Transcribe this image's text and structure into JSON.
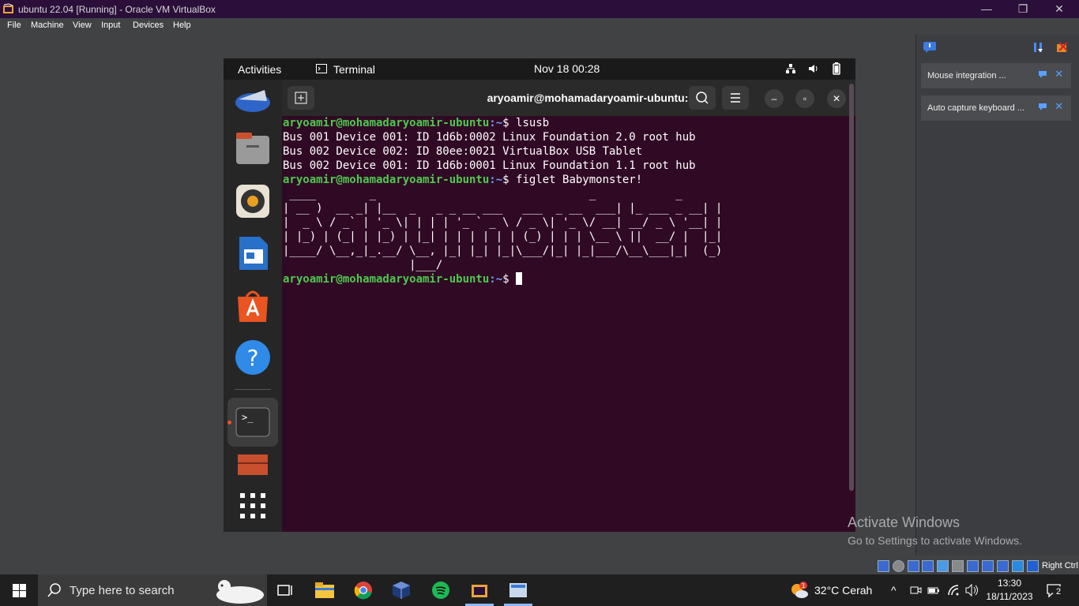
{
  "window": {
    "title": "ubuntu 22.04 [Running] - Oracle VM VirtualBox",
    "controls": [
      "—",
      "❐",
      "✕"
    ]
  },
  "menu": [
    "File",
    "Machine",
    "View",
    "Input",
    "Devices",
    "Help"
  ],
  "notifications": [
    {
      "text": "Mouse integration ..."
    },
    {
      "text": "Auto capture keyboard ..."
    }
  ],
  "gnome": {
    "activities": "Activities",
    "app": "Terminal",
    "clock": "Nov 18  00:28"
  },
  "terminal": {
    "title": "aryoamir@mohamadaryoamir-ubuntu: ~",
    "prompt_user": "aryoamir@mohamadaryoamir-ubuntu",
    "prompt_path": ":~",
    "prompt_sign": "$ ",
    "cmd1": "lsusb",
    "out1": "Bus 001 Device 001: ID 1d6b:0002 Linux Foundation 2.0 root hub",
    "out2": "Bus 002 Device 002: ID 80ee:0021 VirtualBox USB Tablet",
    "out3": "Bus 002 Device 001: ID 1d6b:0001 Linux Foundation 1.1 root hub",
    "cmd2": "figlet Babymonster!",
    "figlet": [
      " ____        _                                _            _ ",
      "| __ )  __ _| |__  _   _ _ __ ___   ___  _ __  ___| |_ ___ _ __| |",
      "|  _ \\ / _` | '_ \\| | | | '_ ` _ \\ / _ \\| '_ \\/ __| __/ _ \\ '__| |",
      "| |_) | (_| | |_) | |_| | | | | | | (_) | | | \\__ \\ ||  __/ |  |_|",
      "|____/ \\__,_|_.__/ \\__, |_| |_| |_|\\___/|_| |_|___/\\__\\___|_|  (_)",
      "                   |___/"
    ]
  },
  "watermark": {
    "line1": "Activate Windows",
    "line2": "Go to Settings to activate Windows."
  },
  "statusbar": {
    "right_ctrl": "Right Ctrl"
  },
  "taskbar": {
    "search_placeholder": "Type here to search",
    "weather": "32°C  Cerah",
    "time": "13:30",
    "date": "18/11/2023",
    "notif_count": "2"
  }
}
